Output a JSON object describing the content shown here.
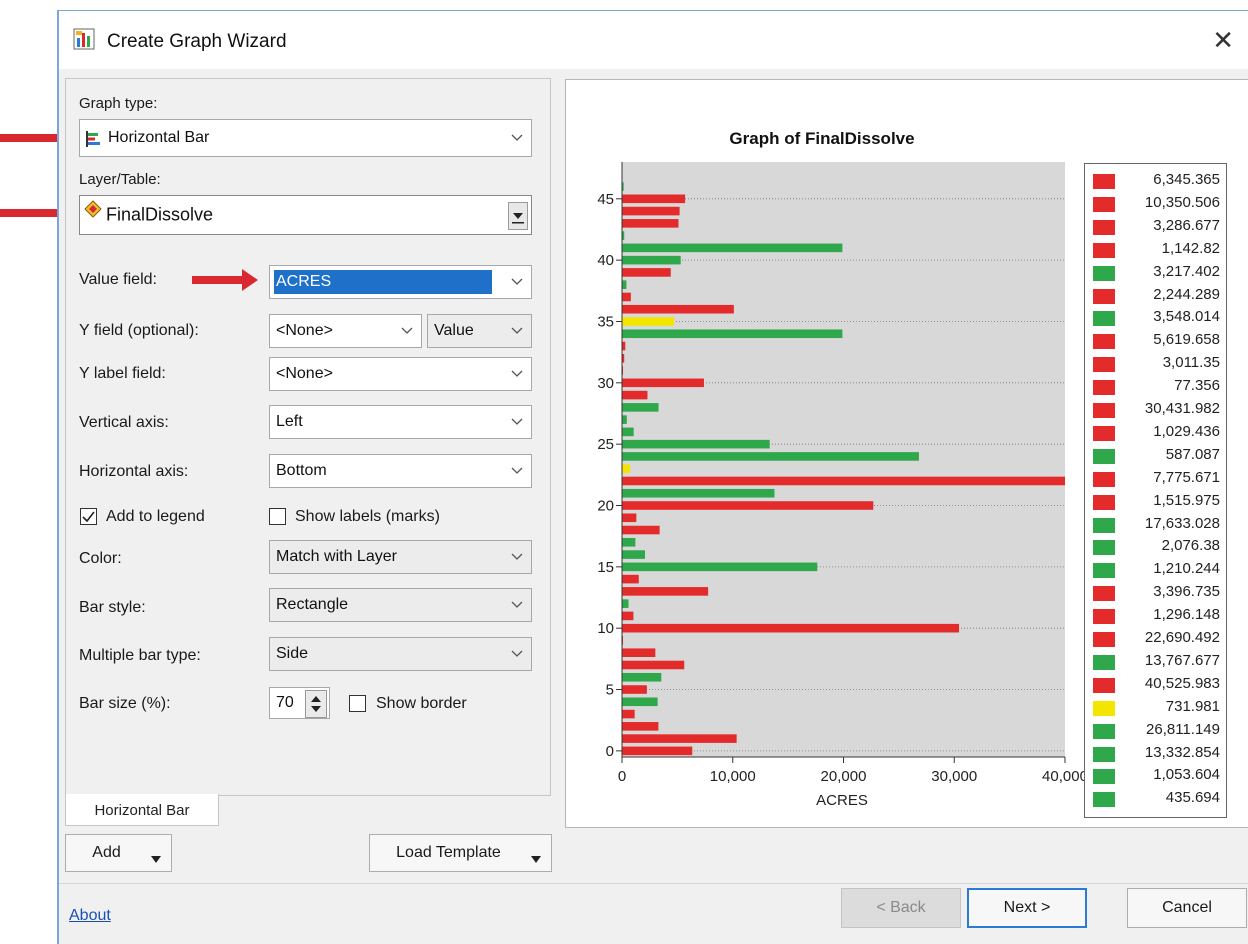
{
  "window": {
    "title": "Create Graph Wizard",
    "close_glyph": "✕"
  },
  "colors": {
    "red": "#e32b2b",
    "green": "#2ea84a",
    "yellow": "#f2e600",
    "selection": "#1e70c8",
    "arrow": "#d9282f"
  },
  "form": {
    "graph_type_label": "Graph type:",
    "graph_type_value": "Horizontal Bar",
    "layer_label": "Layer/Table:",
    "layer_value": "FinalDissolve",
    "value_field_label": "Value field:",
    "value_field_value": "ACRES",
    "y_field_label": "Y field (optional):",
    "y_field_value": "<None>",
    "y_field_type": "Value",
    "y_label_field_label": "Y label field:",
    "y_label_field_value": "<None>",
    "vertical_axis_label": "Vertical axis:",
    "vertical_axis_value": "Left",
    "horizontal_axis_label": "Horizontal axis:",
    "horizontal_axis_value": "Bottom",
    "add_to_legend_label": "Add to legend",
    "add_to_legend_checked": true,
    "show_labels_label": "Show labels (marks)",
    "show_labels_checked": false,
    "color_label": "Color:",
    "color_value": "Match with Layer",
    "bar_style_label": "Bar style:",
    "bar_style_value": "Rectangle",
    "multiple_bar_label": "Multiple bar type:",
    "multiple_bar_value": "Side",
    "bar_size_label": "Bar size (%):",
    "bar_size_value": "70",
    "show_border_label": "Show border",
    "show_border_checked": false
  },
  "tabs": [
    "Horizontal Bar"
  ],
  "buttons": {
    "add": "Add",
    "load_template": "Load Template",
    "back": "< Back",
    "next": "Next >",
    "cancel": "Cancel",
    "about": "About"
  },
  "chart_data": {
    "type": "bar",
    "orientation": "horizontal",
    "title": "Graph of FinalDissolve",
    "xlabel": "ACRES",
    "ylabel": "",
    "xlim": [
      0,
      40000
    ],
    "ylim": [
      -0.5,
      48
    ],
    "x_ticks": [
      "0",
      "10,000",
      "20,000",
      "30,000",
      "40,000"
    ],
    "y_ticks": [
      "0",
      "5",
      "10",
      "15",
      "20",
      "25",
      "30",
      "35",
      "40",
      "45"
    ],
    "grid": "horizontal-dotted",
    "legend_placement": "right",
    "values": [
      6345.365,
      10350.506,
      3286.677,
      1142.82,
      3217.402,
      2244.289,
      3548.014,
      5619.658,
      3011.35,
      77.356,
      30431.982,
      1029.436,
      587.087,
      7775.671,
      1515.975,
      17633.028,
      2076.38,
      1210.244,
      3396.735,
      1296.148,
      22690.492,
      13767.677,
      40525.983,
      731.981,
      26811.149,
      13332.854,
      1053.604,
      435.694,
      3300,
      2300,
      7400,
      90,
      200,
      300,
      19900,
      4700,
      10100,
      800,
      400,
      4400,
      5300,
      19900,
      200,
      5100,
      5200,
      5700,
      150
    ],
    "colors": [
      "red",
      "red",
      "red",
      "red",
      "green",
      "red",
      "green",
      "red",
      "red",
      "red",
      "red",
      "red",
      "green",
      "red",
      "red",
      "green",
      "green",
      "green",
      "red",
      "red",
      "red",
      "green",
      "red",
      "yellow",
      "green",
      "green",
      "green",
      "green",
      "green",
      "red",
      "red",
      "red",
      "red",
      "red",
      "green",
      "yellow",
      "red",
      "red",
      "green",
      "red",
      "green",
      "green",
      "green",
      "red",
      "red",
      "red",
      "green"
    ],
    "legend": [
      {
        "label": "6,345.365",
        "color": "red"
      },
      {
        "label": "10,350.506",
        "color": "red"
      },
      {
        "label": "3,286.677",
        "color": "red"
      },
      {
        "label": "1,142.82",
        "color": "red"
      },
      {
        "label": "3,217.402",
        "color": "green"
      },
      {
        "label": "2,244.289",
        "color": "red"
      },
      {
        "label": "3,548.014",
        "color": "green"
      },
      {
        "label": "5,619.658",
        "color": "red"
      },
      {
        "label": "3,011.35",
        "color": "red"
      },
      {
        "label": "77.356",
        "color": "red"
      },
      {
        "label": "30,431.982",
        "color": "red"
      },
      {
        "label": "1,029.436",
        "color": "red"
      },
      {
        "label": "587.087",
        "color": "green"
      },
      {
        "label": "7,775.671",
        "color": "red"
      },
      {
        "label": "1,515.975",
        "color": "red"
      },
      {
        "label": "17,633.028",
        "color": "green"
      },
      {
        "label": "2,076.38",
        "color": "green"
      },
      {
        "label": "1,210.244",
        "color": "green"
      },
      {
        "label": "3,396.735",
        "color": "red"
      },
      {
        "label": "1,296.148",
        "color": "red"
      },
      {
        "label": "22,690.492",
        "color": "red"
      },
      {
        "label": "13,767.677",
        "color": "green"
      },
      {
        "label": "40,525.983",
        "color": "red"
      },
      {
        "label": "731.981",
        "color": "yellow"
      },
      {
        "label": "26,811.149",
        "color": "green"
      },
      {
        "label": "13,332.854",
        "color": "green"
      },
      {
        "label": "1,053.604",
        "color": "green"
      },
      {
        "label": "435.694",
        "color": "green"
      }
    ]
  }
}
